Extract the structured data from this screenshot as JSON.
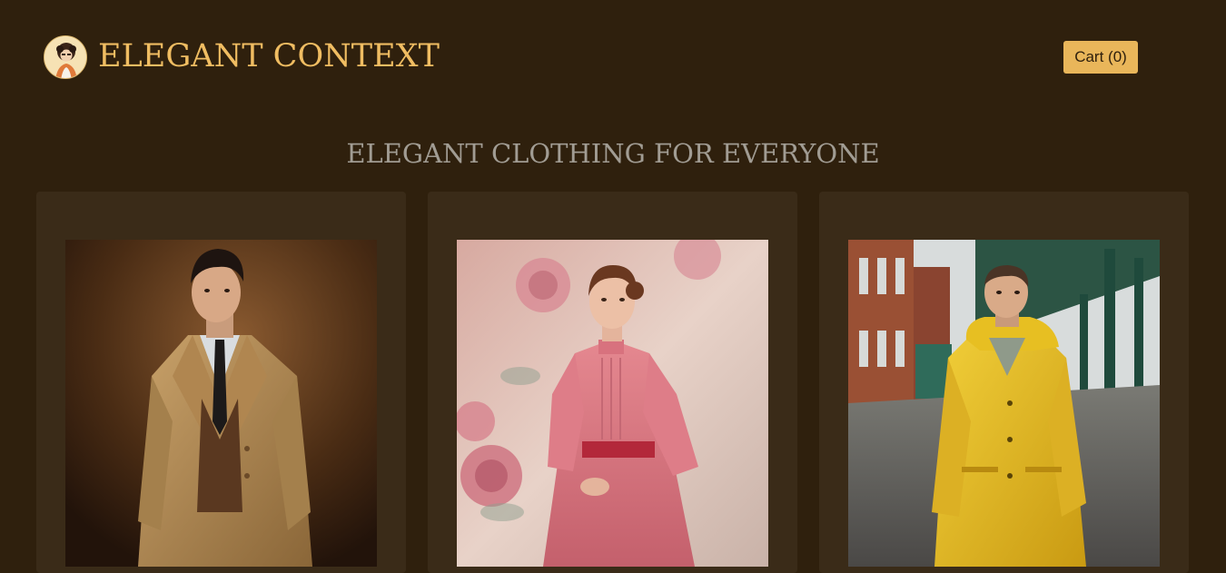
{
  "header": {
    "site_title": "ELEGANT CONTEXT",
    "logo_icon": "vintage-lady-portrait-logo",
    "cart_label": "Cart (0)"
  },
  "main": {
    "heading": "ELEGANT CLOTHING FOR EVERYONE",
    "products": [
      {
        "image": "man-in-trench-coat-photo"
      },
      {
        "image": "woman-in-pink-dress-photo"
      },
      {
        "image": "man-in-yellow-raincoat-photo"
      }
    ]
  },
  "colors": {
    "background": "#2f200d",
    "card": "#3a2b18",
    "accent": "#e9b65a",
    "title": "#f0bd62",
    "heading": "#a19c93"
  }
}
